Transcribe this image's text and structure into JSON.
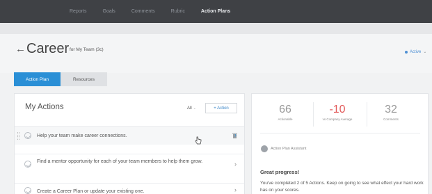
{
  "nav": {
    "items": [
      "Reports",
      "Goals",
      "Comments",
      "Rubric",
      "Action Plans"
    ],
    "active_index": 4
  },
  "header": {
    "title": "Career",
    "subtitle": "for My Team (3c)",
    "status": "Active"
  },
  "tabs": [
    "Action Plan",
    "Resources"
  ],
  "actions": {
    "heading": "My Actions",
    "filter": "All",
    "add_label": "+ Action",
    "items": [
      {
        "text": "Help your team make career connections."
      },
      {
        "text": "Find a mentor opportunity for each of your team members to help them grow."
      },
      {
        "text": "Create a Career Plan or update your existing one."
      }
    ]
  },
  "stats": [
    {
      "value": "66",
      "label": "Actionable"
    },
    {
      "value": "-10",
      "label": "vs Company Average"
    },
    {
      "value": "32",
      "label": "Comments"
    }
  ],
  "assist": {
    "text": "Action Plan Assistant"
  },
  "progress": {
    "title": "Great progress!",
    "text": "You've completed 2 of 5 Actions. Keep on going to see what effect your hard work has on your scores."
  },
  "colors": {
    "accent": "#2a8fd6",
    "negative": "#e25a5a",
    "nav_bg": "#3f4145"
  }
}
